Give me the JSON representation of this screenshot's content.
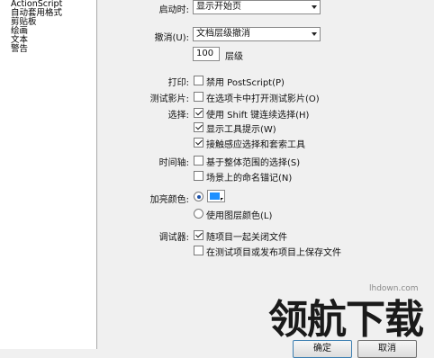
{
  "sidebar": {
    "items": [
      "ActionScript",
      "自动套用格式",
      "剪贴板",
      "绘画",
      "文本",
      "警告"
    ]
  },
  "general": {
    "startup_label": "启动时:",
    "startup_value": "显示开始页",
    "undo_label": "撤消(U):",
    "undo_value": "文档层级撤消",
    "levels_value": "100",
    "levels_unit": "层级",
    "print_label": "打印:",
    "print_option": "禁用 PostScript(P)",
    "test_movie_label": "测试影片:",
    "test_movie_option": "在选项卡中打开测试影片(O)",
    "selection_label": "选择:",
    "selection_options": [
      "使用 Shift 键连续选择(H)",
      "显示工具提示(W)",
      "接触感应选择和套索工具"
    ],
    "timeline_label": "时间轴:",
    "timeline_options": [
      "基于整体范围的选择(S)",
      "场景上的命名锚记(N)"
    ],
    "highlight_label": "加亮颜色:",
    "highlight_color": "#1e90ff",
    "highlight_layer_option": "使用图层颜色(L)",
    "debugger_label": "调试器:",
    "debugger_options": [
      "随项目一起关闭文件",
      "在测试项目或发布项目上保存文件"
    ]
  },
  "buttons": {
    "ok": "确定",
    "cancel": "取消"
  },
  "watermark": {
    "text": "领航下载",
    "url": "lhdown.com"
  }
}
